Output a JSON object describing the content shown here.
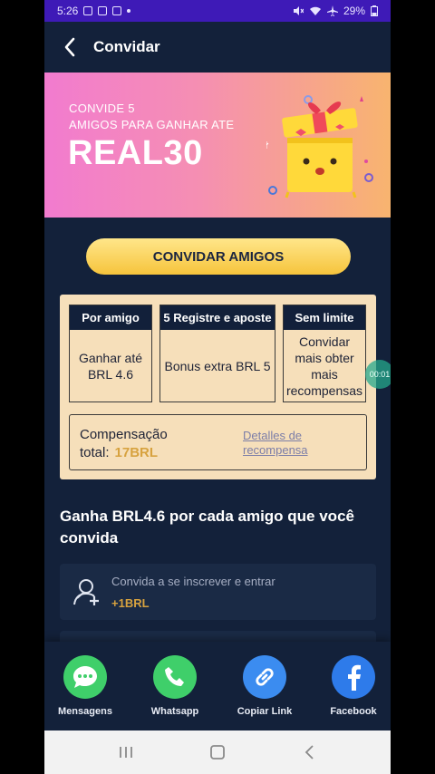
{
  "status_bar": {
    "time": "5:26",
    "battery": "29%"
  },
  "header": {
    "title": "Convidar"
  },
  "banner": {
    "line1": "CONVIDE 5",
    "line2": "AMIGOS PARA GANHAR ATE",
    "amount": "REAL30"
  },
  "invite_button": {
    "label": "CONVIDAR AMIGOS"
  },
  "tiers": [
    {
      "head": "Por amigo",
      "body": "Ganhar até BRL 4.6"
    },
    {
      "head": "5 Registre e aposte",
      "body": "Bonus extra BRL 5"
    },
    {
      "head": "Sem limite",
      "body": "Convidar mais obter mais recompensas"
    }
  ],
  "compensation": {
    "label_line1": "Compensação",
    "label_line2": "total:",
    "value": "17BRL",
    "details_line1": "Detalles de",
    "details_line2": "recompensa"
  },
  "timer": "00:01",
  "headline": "Ganha BRL4.6 por cada amigo que você convida",
  "steps": [
    {
      "label": "Convida a se inscrever e entrar",
      "reward": "+1BRL",
      "icon": "add-user-icon"
    }
  ],
  "share_options": [
    {
      "label": "Mensagens",
      "icon": "chat-bubble-icon",
      "color": "#3fcf6a"
    },
    {
      "label": "Whatsapp",
      "icon": "phone-icon",
      "color": "#3fcf6a"
    },
    {
      "label": "Copiar Link",
      "icon": "link-icon",
      "color": "#3b8cf0"
    },
    {
      "label": "Facebook",
      "icon": "facebook-icon",
      "color": "#2e7bea"
    }
  ],
  "colors": {
    "status_bar": "#3e1ab7",
    "background": "#13213a",
    "accent_gold": "#f6c43c",
    "reward_text": "#d7a23f",
    "panel": "#f6dfba"
  }
}
